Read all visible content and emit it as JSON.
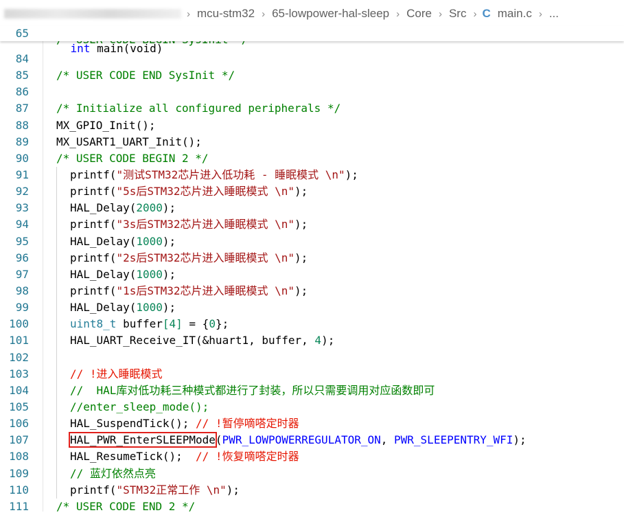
{
  "breadcrumb": {
    "items": [
      "mcu-stm32",
      "65-lowpower-hal-sleep",
      "Core",
      "Src"
    ],
    "file": "main.c",
    "file_icon": "C",
    "more": "..."
  },
  "sticky": {
    "line_no": "65",
    "kw": "int",
    "fn": "main",
    "args": "(void)"
  },
  "partial_line": {
    "text": "/* USER CODE BEGIN SysInit */"
  },
  "lines": [
    {
      "n": "84",
      "t": ""
    },
    {
      "n": "85",
      "t": "/* USER CODE END SysInit */"
    },
    {
      "n": "86",
      "t": ""
    },
    {
      "n": "87",
      "t": "/* Initialize all configured peripherals */"
    },
    {
      "n": "88",
      "a": "MX_GPIO_Init",
      "b": "();"
    },
    {
      "n": "89",
      "a": "MX_USART1_UART_Init",
      "b": "();"
    },
    {
      "n": "90",
      "t": "/* USER CODE BEGIN 2 */"
    },
    {
      "n": "91",
      "fn": "printf",
      "s": "\"测试STM32芯片进入低功耗 - 睡眠模式 \\n\"",
      "e": ");"
    },
    {
      "n": "92",
      "fn": "printf",
      "s": "\"5s后STM32芯片进入睡眠模式 \\n\"",
      "e": ");"
    },
    {
      "n": "93",
      "fn": "HAL_Delay",
      "v": "2000",
      "e": ");"
    },
    {
      "n": "94",
      "fn": "printf",
      "s": "\"3s后STM32芯片进入睡眠模式 \\n\"",
      "e": ");"
    },
    {
      "n": "95",
      "fn": "HAL_Delay",
      "v": "1000",
      "e": ");"
    },
    {
      "n": "96",
      "fn": "printf",
      "s": "\"2s后STM32芯片进入睡眠模式 \\n\"",
      "e": ");"
    },
    {
      "n": "97",
      "fn": "HAL_Delay",
      "v": "1000",
      "e": ");"
    },
    {
      "n": "98",
      "fn": "printf",
      "s": "\"1s后STM32芯片进入睡眠模式 \\n\"",
      "e": ");"
    },
    {
      "n": "99",
      "fn": "HAL_Delay",
      "v": "1000",
      "e": ");"
    },
    {
      "n": "100",
      "type": "uint8_t",
      "rest1": " buffer",
      "idx": "[4]",
      "rest2": " = {",
      "zero": "0",
      "rest3": "};"
    },
    {
      "n": "101",
      "a": "HAL_UART_Receive_IT",
      "b": "(&huart1, buffer, ",
      "c": "4",
      "d": ");"
    },
    {
      "n": "102",
      "t": ""
    },
    {
      "n": "103",
      "rc": "// !进入睡眠模式"
    },
    {
      "n": "104",
      "gc": "//  HAL库对低功耗三种模式都进行了封装，所以只需要调用对应函数即可"
    },
    {
      "n": "105",
      "gc": "//enter_sleep_mode();"
    },
    {
      "n": "106",
      "a": "HAL_SuspendTick",
      "b": "(); ",
      "rc": "// !暂停嘀嗒定时器"
    },
    {
      "n": "107",
      "a": "HAL_PWR_EnterSLEEPMode",
      "p": "(",
      "m1": "PWR_LOWPOWERREGULATOR_ON",
      "p2": ", ",
      "m2": "PWR_SLEEPENTRY_WFI",
      "p3": ");"
    },
    {
      "n": "108",
      "a": "HAL_ResumeTick",
      "b": "();  ",
      "rc": "// !恢复嘀嗒定时器"
    },
    {
      "n": "109",
      "gc": "// 蓝灯依然点亮"
    },
    {
      "n": "110",
      "fn": "printf",
      "s": "\"STM32正常工作 \\n\"",
      "e": ");"
    },
    {
      "n": "111",
      "t": "/* USER CODE END 2 */"
    }
  ]
}
